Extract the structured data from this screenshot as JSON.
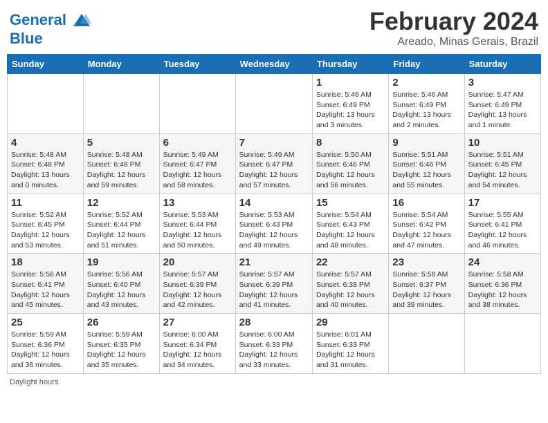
{
  "header": {
    "logo_line1": "General",
    "logo_line2": "Blue",
    "month": "February 2024",
    "location": "Areado, Minas Gerais, Brazil"
  },
  "days_of_week": [
    "Sunday",
    "Monday",
    "Tuesday",
    "Wednesday",
    "Thursday",
    "Friday",
    "Saturday"
  ],
  "weeks": [
    [
      {
        "day": "",
        "info": ""
      },
      {
        "day": "",
        "info": ""
      },
      {
        "day": "",
        "info": ""
      },
      {
        "day": "",
        "info": ""
      },
      {
        "day": "1",
        "info": "Sunrise: 5:46 AM\nSunset: 6:49 PM\nDaylight: 13 hours\nand 3 minutes."
      },
      {
        "day": "2",
        "info": "Sunrise: 5:46 AM\nSunset: 6:49 PM\nDaylight: 13 hours\nand 2 minutes."
      },
      {
        "day": "3",
        "info": "Sunrise: 5:47 AM\nSunset: 6:49 PM\nDaylight: 13 hours\nand 1 minute."
      }
    ],
    [
      {
        "day": "4",
        "info": "Sunrise: 5:48 AM\nSunset: 6:48 PM\nDaylight: 13 hours\nand 0 minutes."
      },
      {
        "day": "5",
        "info": "Sunrise: 5:48 AM\nSunset: 6:48 PM\nDaylight: 12 hours\nand 59 minutes."
      },
      {
        "day": "6",
        "info": "Sunrise: 5:49 AM\nSunset: 6:47 PM\nDaylight: 12 hours\nand 58 minutes."
      },
      {
        "day": "7",
        "info": "Sunrise: 5:49 AM\nSunset: 6:47 PM\nDaylight: 12 hours\nand 57 minutes."
      },
      {
        "day": "8",
        "info": "Sunrise: 5:50 AM\nSunset: 6:46 PM\nDaylight: 12 hours\nand 56 minutes."
      },
      {
        "day": "9",
        "info": "Sunrise: 5:51 AM\nSunset: 6:46 PM\nDaylight: 12 hours\nand 55 minutes."
      },
      {
        "day": "10",
        "info": "Sunrise: 5:51 AM\nSunset: 6:45 PM\nDaylight: 12 hours\nand 54 minutes."
      }
    ],
    [
      {
        "day": "11",
        "info": "Sunrise: 5:52 AM\nSunset: 6:45 PM\nDaylight: 12 hours\nand 53 minutes."
      },
      {
        "day": "12",
        "info": "Sunrise: 5:52 AM\nSunset: 6:44 PM\nDaylight: 12 hours\nand 51 minutes."
      },
      {
        "day": "13",
        "info": "Sunrise: 5:53 AM\nSunset: 6:44 PM\nDaylight: 12 hours\nand 50 minutes."
      },
      {
        "day": "14",
        "info": "Sunrise: 5:53 AM\nSunset: 6:43 PM\nDaylight: 12 hours\nand 49 minutes."
      },
      {
        "day": "15",
        "info": "Sunrise: 5:54 AM\nSunset: 6:43 PM\nDaylight: 12 hours\nand 48 minutes."
      },
      {
        "day": "16",
        "info": "Sunrise: 5:54 AM\nSunset: 6:42 PM\nDaylight: 12 hours\nand 47 minutes."
      },
      {
        "day": "17",
        "info": "Sunrise: 5:55 AM\nSunset: 6:41 PM\nDaylight: 12 hours\nand 46 minutes."
      }
    ],
    [
      {
        "day": "18",
        "info": "Sunrise: 5:56 AM\nSunset: 6:41 PM\nDaylight: 12 hours\nand 45 minutes."
      },
      {
        "day": "19",
        "info": "Sunrise: 5:56 AM\nSunset: 6:40 PM\nDaylight: 12 hours\nand 43 minutes."
      },
      {
        "day": "20",
        "info": "Sunrise: 5:57 AM\nSunset: 6:39 PM\nDaylight: 12 hours\nand 42 minutes."
      },
      {
        "day": "21",
        "info": "Sunrise: 5:57 AM\nSunset: 6:39 PM\nDaylight: 12 hours\nand 41 minutes."
      },
      {
        "day": "22",
        "info": "Sunrise: 5:57 AM\nSunset: 6:38 PM\nDaylight: 12 hours\nand 40 minutes."
      },
      {
        "day": "23",
        "info": "Sunrise: 5:58 AM\nSunset: 6:37 PM\nDaylight: 12 hours\nand 39 minutes."
      },
      {
        "day": "24",
        "info": "Sunrise: 5:58 AM\nSunset: 6:36 PM\nDaylight: 12 hours\nand 38 minutes."
      }
    ],
    [
      {
        "day": "25",
        "info": "Sunrise: 5:59 AM\nSunset: 6:36 PM\nDaylight: 12 hours\nand 36 minutes."
      },
      {
        "day": "26",
        "info": "Sunrise: 5:59 AM\nSunset: 6:35 PM\nDaylight: 12 hours\nand 35 minutes."
      },
      {
        "day": "27",
        "info": "Sunrise: 6:00 AM\nSunset: 6:34 PM\nDaylight: 12 hours\nand 34 minutes."
      },
      {
        "day": "28",
        "info": "Sunrise: 6:00 AM\nSunset: 6:33 PM\nDaylight: 12 hours\nand 33 minutes."
      },
      {
        "day": "29",
        "info": "Sunrise: 6:01 AM\nSunset: 6:33 PM\nDaylight: 12 hours\nand 31 minutes."
      },
      {
        "day": "",
        "info": ""
      },
      {
        "day": "",
        "info": ""
      }
    ]
  ],
  "footer": "Daylight hours"
}
